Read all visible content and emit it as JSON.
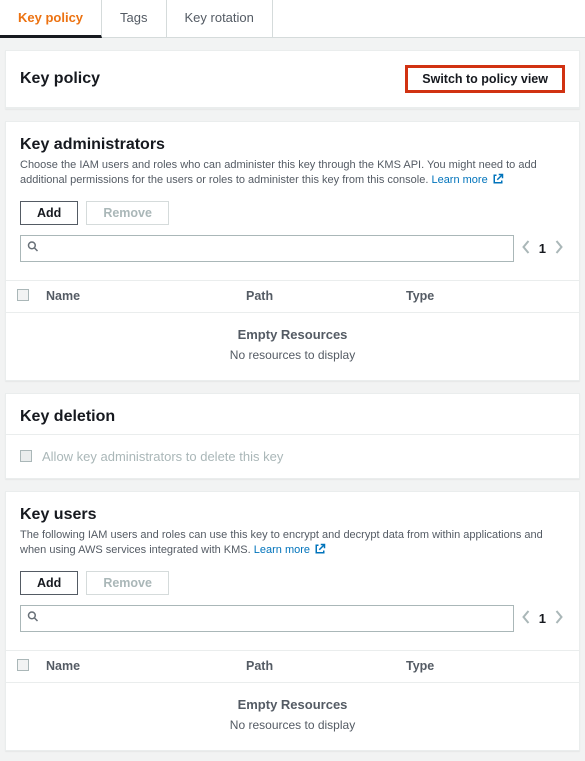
{
  "tabs": {
    "key_policy": "Key policy",
    "tags": "Tags",
    "key_rotation": "Key rotation"
  },
  "header": {
    "title": "Key policy",
    "switch_btn": "Switch to policy view"
  },
  "admins": {
    "title": "Key administrators",
    "desc": "Choose the IAM users and roles who can administer this key through the KMS API. You might need to add additional permissions for the users or roles to administer this key from this console. ",
    "learn_more": "Learn more",
    "add": "Add",
    "remove": "Remove",
    "page": "1",
    "cols": {
      "name": "Name",
      "path": "Path",
      "type": "Type"
    },
    "empty_title": "Empty Resources",
    "empty_sub": "No resources to display"
  },
  "deletion": {
    "title": "Key deletion",
    "checkbox_label": "Allow key administrators to delete this key"
  },
  "users": {
    "title": "Key users",
    "desc": "The following IAM users and roles can use this key to encrypt and decrypt data from within applications and when using AWS services integrated with KMS. ",
    "learn_more": "Learn more",
    "add": "Add",
    "remove": "Remove",
    "page": "1",
    "cols": {
      "name": "Name",
      "path": "Path",
      "type": "Type"
    },
    "empty_title": "Empty Resources",
    "empty_sub": "No resources to display"
  }
}
